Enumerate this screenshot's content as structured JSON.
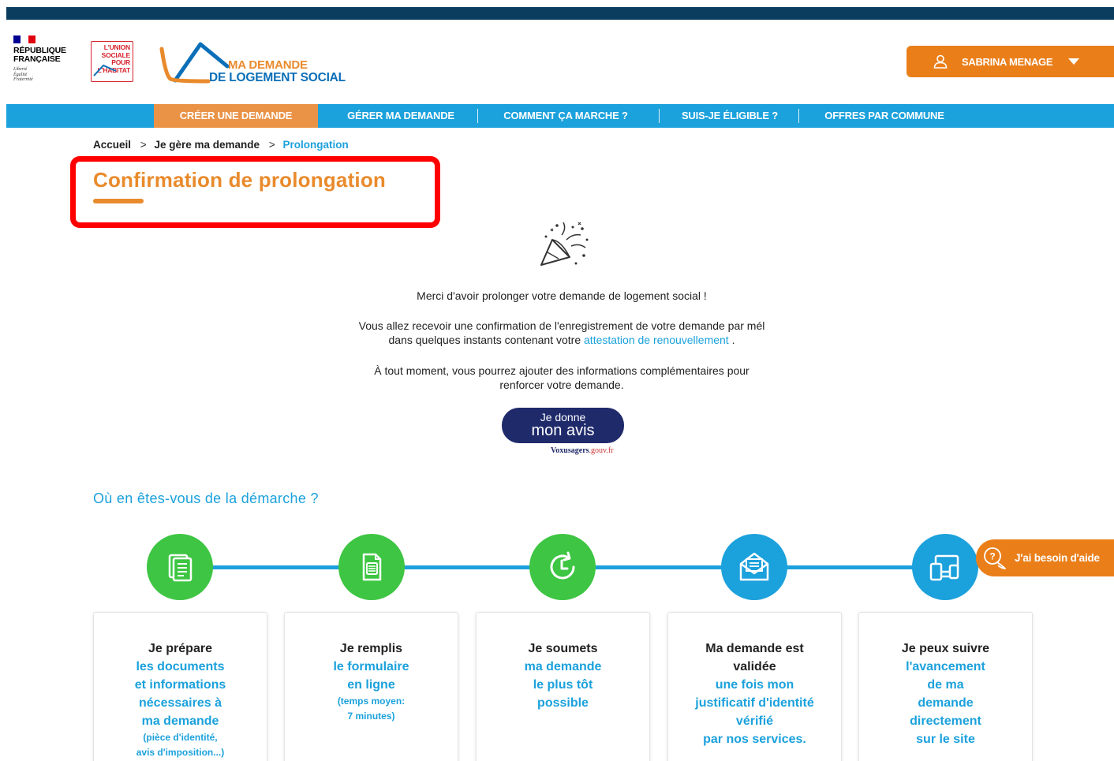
{
  "header": {
    "rf_text": "RÉPUBLIQUE\nFRANÇAISE",
    "rf_motto": "Liberté\nÉgalité\nFraternité",
    "ush_text": "L'UNION\nSOCIALE\nPOUR\nL'HABITAT",
    "app_title_line1": "MA DEMANDE",
    "app_title_line2": "DE LOGEMENT SOCIAL",
    "user_name": "SABRINA MENAGE"
  },
  "nav": {
    "items": [
      {
        "label": "CRÉER UNE DEMANDE",
        "active": true
      },
      {
        "label": "GÉRER MA DEMANDE",
        "active": false
      },
      {
        "label": "COMMENT ÇA MARCHE ?",
        "active": false
      },
      {
        "label": "SUIS-JE ÉLIGIBLE ?",
        "active": false
      },
      {
        "label": "OFFRES PAR COMMUNE",
        "active": false
      }
    ]
  },
  "breadcrumb": {
    "items": [
      "Accueil",
      "Je gère ma demande",
      "Prolongation"
    ],
    "separator": ">"
  },
  "page": {
    "title": "Confirmation de prolongation",
    "thanks": "Merci d'avoir prolonger votre demande de logement social !",
    "email_line1": "Vous allez recevoir une confirmation de l'enregistrement de votre demande par mél",
    "email_line2_before": "dans quelques instants contenant votre ",
    "email_link": "attestation de renouvellement",
    "email_line2_after": " .",
    "anytime_line1": "À tout moment, vous pourrez ajouter des informations complémentaires pour",
    "anytime_line2": "renforcer votre demande.",
    "avis_small": "Je donne",
    "avis_big": "mon avis",
    "vox_brand": "Voxusagers",
    "vox_domain": ".gouv.fr"
  },
  "steps": {
    "section_title": "Où en êtes-vous de la démarche ?",
    "cards": [
      {
        "head": "Je prépare",
        "body": "les documents\net informations\nnécessaires à\nma demande",
        "note": "(pièce d'identité,\navis d'imposition...)"
      },
      {
        "head": "Je remplis",
        "body": "le formulaire\nen ligne",
        "note": "(temps moyen:\n7 minutes)"
      },
      {
        "head": "Je soumets",
        "body": "ma demande\nle plus tôt\npossible",
        "note": ""
      },
      {
        "head": "Ma demande est\nvalidée",
        "body": "une fois mon\njustificatif d'identité\nvérifié\npar nos services.",
        "note": ""
      },
      {
        "head": "Je peux suivre",
        "body": "l'avancement\nde ma\ndemande\ndirectement\nsur le site",
        "note": ""
      }
    ],
    "icons": [
      "documents-icon",
      "form-icon",
      "clock-refresh-icon",
      "envelope-icon",
      "devices-icon"
    ]
  },
  "help": {
    "label": "J'ai besoin d'aide"
  },
  "colors": {
    "orange": "#ea7f1a",
    "title_orange": "#e98a2c",
    "blue": "#1ba1dc",
    "navy": "#0b3d5e",
    "green": "#3ec543",
    "avis_navy": "#1f2a6b",
    "highlight_red": "#ff0000"
  }
}
